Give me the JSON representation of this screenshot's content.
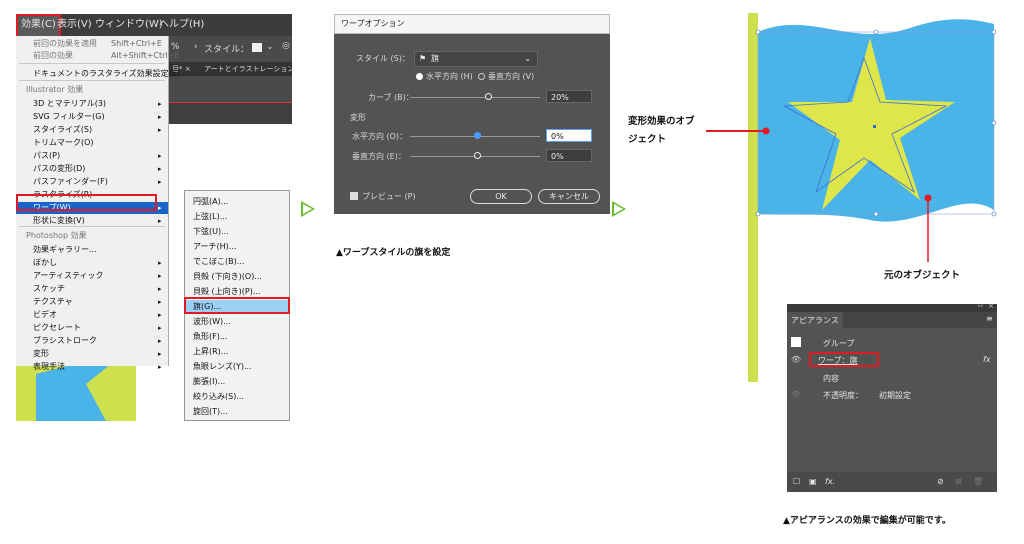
{
  "menu_panel": {
    "menubar": [
      "効果(C)",
      "表示(V)",
      "ウィンドウ(W)",
      "ヘルプ(H)"
    ],
    "toolbar_zoom": "%",
    "toolbar_style_label": "スタイル：",
    "tab_text": "アートとイラストレーション.ai",
    "tab_prefix": "旦* ×",
    "items": [
      {
        "label": "前回の効果を適用",
        "shortcut": "Shift+Ctrl+E",
        "disabled": true
      },
      {
        "label": "前回の効果",
        "shortcut": "Alt+Shift+Ctrl+E",
        "disabled": true
      },
      {
        "label": "ドキュメントのラスタライズ効果設定(E)..."
      },
      {
        "label": "Illustrator 効果",
        "header": true
      },
      {
        "label": "3D とマテリアル(3)",
        "submenu": true
      },
      {
        "label": "SVG フィルター(G)",
        "submenu": true
      },
      {
        "label": "スタイライズ(S)",
        "submenu": true
      },
      {
        "label": "トリムマーク(O)"
      },
      {
        "label": "パス(P)",
        "submenu": true
      },
      {
        "label": "パスの変形(D)",
        "submenu": true
      },
      {
        "label": "パスファインダー(F)",
        "submenu": true
      },
      {
        "label": "ラスタライズ(R)"
      },
      {
        "label": "ワープ(W)",
        "submenu": true,
        "highlighted": true
      },
      {
        "label": "形状に変換(V)",
        "submenu": true
      },
      {
        "label": "Photoshop 効果",
        "header": true
      },
      {
        "label": "効果ギャラリー..."
      },
      {
        "label": "ぼかし",
        "submenu": true
      },
      {
        "label": "アーティスティック",
        "submenu": true
      },
      {
        "label": "スケッチ",
        "submenu": true
      },
      {
        "label": "テクスチャ",
        "submenu": true
      },
      {
        "label": "ビデオ",
        "submenu": true
      },
      {
        "label": "ピクセレート",
        "submenu": true
      },
      {
        "label": "ブラシストローク",
        "submenu": true
      },
      {
        "label": "変形",
        "submenu": true
      },
      {
        "label": "表現手法",
        "submenu": true
      }
    ],
    "warp_submenu": [
      "円弧(A)...",
      "上弦(L)...",
      "下弦(U)...",
      "アーチ(H)...",
      "でこぼこ(B)...",
      "貝殻 (下向き)(O)...",
      "貝殻 (上向き)(P)...",
      "旗(G)...",
      "波形(W)...",
      "魚形(F)...",
      "上昇(R)...",
      "魚眼レンズ(Y)...",
      "膨張(I)...",
      "絞り込み(S)...",
      "旋回(T)..."
    ],
    "warp_selected": "旗(G)..."
  },
  "warp_dialog": {
    "title": "ワープオプション",
    "style_label": "スタイル (S)：",
    "style_value": "旗",
    "horizontal_label": "水平方向 (H)",
    "vertical_label": "垂直方向 (V)",
    "bend_label": "カーブ (B)：",
    "bend_value": "20%",
    "distortion_label": "変形",
    "dist_h_label": "水平方向 (O)：",
    "dist_h_value": "0%",
    "dist_v_label": "垂直方向 (E)：",
    "dist_v_value": "0%",
    "preview_label": "プレビュー (P)",
    "ok_label": "OK",
    "cancel_label": "キャンセル",
    "caption": "▲ワープスタイルの旗を設定"
  },
  "flag_panel": {
    "label_warped": [
      "変形効果のオブ",
      "ジェクト"
    ],
    "label_original": "元のオブジェクト",
    "colors": {
      "flag": "#4ab3e8",
      "star": "#dfe64a",
      "pole": "#cfe04f",
      "marker": "#e21b23"
    }
  },
  "appearance": {
    "title": "アピアランス",
    "group": "グループ",
    "effect": "ワープ：旗",
    "content": "内容",
    "opacity_label": "不透明度：",
    "opacity_value": "初期設定",
    "caption": "▲アピアランスの効果で編集が可能です。"
  }
}
